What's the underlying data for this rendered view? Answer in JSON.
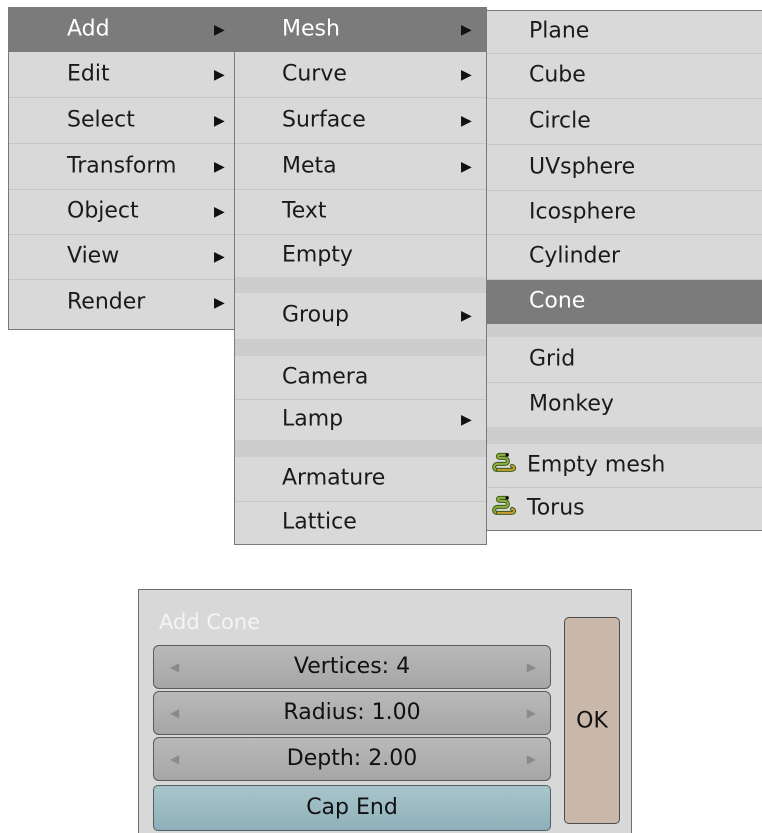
{
  "menu1": {
    "items": [
      {
        "label": "Add",
        "arrow": "▶"
      },
      {
        "label": "Edit",
        "arrow": "▶"
      },
      {
        "label": "Select",
        "arrow": "▶"
      },
      {
        "label": "Transform",
        "arrow": "▶"
      },
      {
        "label": "Object",
        "arrow": "▶"
      },
      {
        "label": "View",
        "arrow": "▶"
      },
      {
        "label": "Render",
        "arrow": "▶"
      }
    ]
  },
  "menu2": {
    "items": [
      {
        "label": "Mesh",
        "arrow": "▶"
      },
      {
        "label": "Curve",
        "arrow": "▶"
      },
      {
        "label": "Surface",
        "arrow": "▶"
      },
      {
        "label": "Meta",
        "arrow": "▶"
      },
      {
        "label": "Text"
      },
      {
        "label": "Empty"
      },
      {
        "label": "Group",
        "arrow": "▶"
      },
      {
        "label": "Camera"
      },
      {
        "label": "Lamp",
        "arrow": "▶"
      },
      {
        "label": "Armature"
      },
      {
        "label": "Lattice"
      }
    ]
  },
  "menu3": {
    "items": [
      {
        "label": "Plane"
      },
      {
        "label": "Cube"
      },
      {
        "label": "Circle"
      },
      {
        "label": "UVsphere"
      },
      {
        "label": "Icosphere"
      },
      {
        "label": "Cylinder"
      },
      {
        "label": "Cone"
      },
      {
        "label": "Grid"
      },
      {
        "label": "Monkey"
      },
      {
        "label": "Empty mesh",
        "icon": "python-snake-icon"
      },
      {
        "label": "Torus",
        "icon": "python-snake-icon"
      }
    ]
  },
  "dialog": {
    "title": "Add Cone",
    "fields": [
      {
        "label": "Vertices: 4"
      },
      {
        "label": "Radius: 1.00"
      },
      {
        "label": "Depth: 2.00"
      }
    ],
    "toggle": "Cap End",
    "ok": "OK",
    "arrow_left": "◀",
    "arrow_right": "▶"
  },
  "colors": {
    "menu_bg": "#d9d9d9",
    "highlight": "#7b7b7b",
    "toggle_bg": "#a0bec6",
    "ok_bg": "#c9b8aa"
  }
}
